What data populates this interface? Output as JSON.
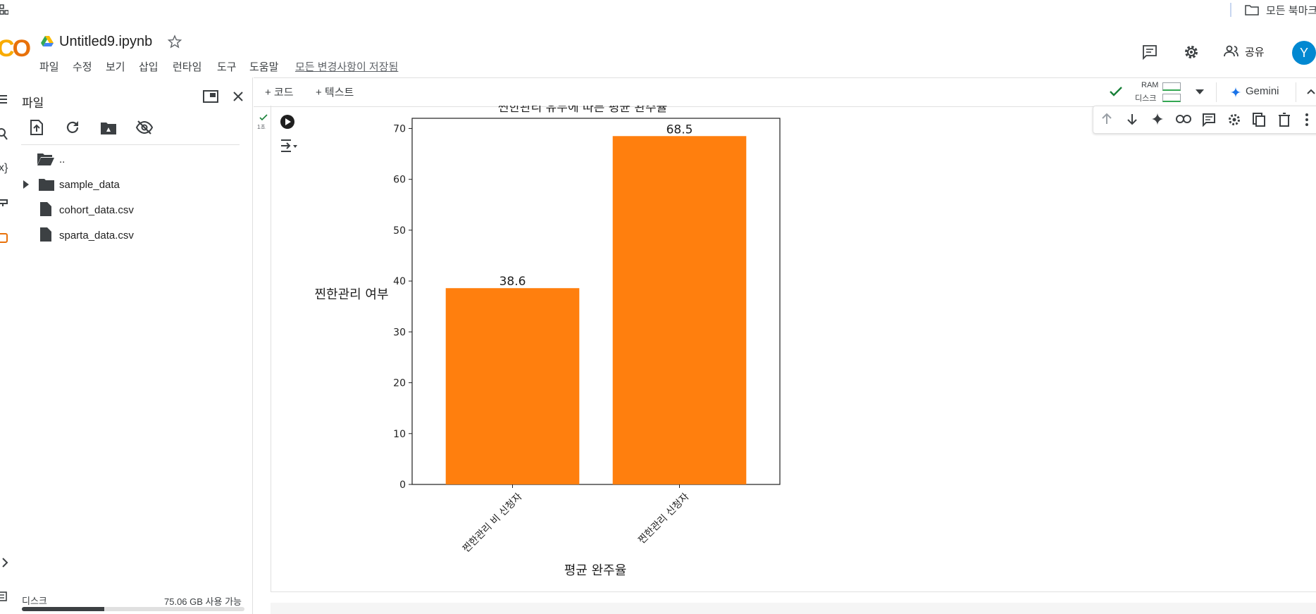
{
  "bookmarks": {
    "all_bookmarks_label": "모든 북마크"
  },
  "header": {
    "logo": "CO",
    "notebook_title": "Untitled9.ipynb",
    "menu": [
      "파일",
      "수정",
      "보기",
      "삽입",
      "런타임",
      "도구",
      "도움말"
    ],
    "save_status": "모든 변경사항이 저장됨",
    "share_label": "공유",
    "avatar_letter": "Y"
  },
  "toolbar": {
    "add_code": "+ 코드",
    "add_text": "+ 텍스트",
    "ram_label": "RAM",
    "disk_label": "디스크",
    "gemini_label": "Gemini"
  },
  "sidebar": {
    "title": "파일",
    "files": [
      {
        "name": "..",
        "type": "parent"
      },
      {
        "name": "sample_data",
        "type": "folder"
      },
      {
        "name": "cohort_data.csv",
        "type": "file"
      },
      {
        "name": "sparta_data.csv",
        "type": "file"
      }
    ],
    "disk_label": "디스크",
    "disk_available": "75.06 GB 사용 가능",
    "disk_used_fraction": 0.37
  },
  "cell": {
    "exec_time": "1초"
  },
  "chart_data": {
    "type": "bar",
    "title": "찐한관리 유무에 따른 평균 완주율",
    "categories": [
      "찐한관리 비 신청자",
      "찐한관리 신청자"
    ],
    "values": [
      38.6,
      68.5
    ],
    "value_labels": [
      "38.6",
      "68.5"
    ],
    "xlabel": "평균 완주율",
    "ylabel": "찐한관리 여부",
    "ylim": [
      0,
      72
    ],
    "yticks": [
      0,
      10,
      20,
      30,
      40,
      50,
      60,
      70
    ],
    "bar_color": "#ff7f0e",
    "grid": false
  },
  "colors": {
    "accent_blue": "#1a73e8",
    "check_green": "#188038",
    "bar_orange": "#ff7f0e"
  }
}
